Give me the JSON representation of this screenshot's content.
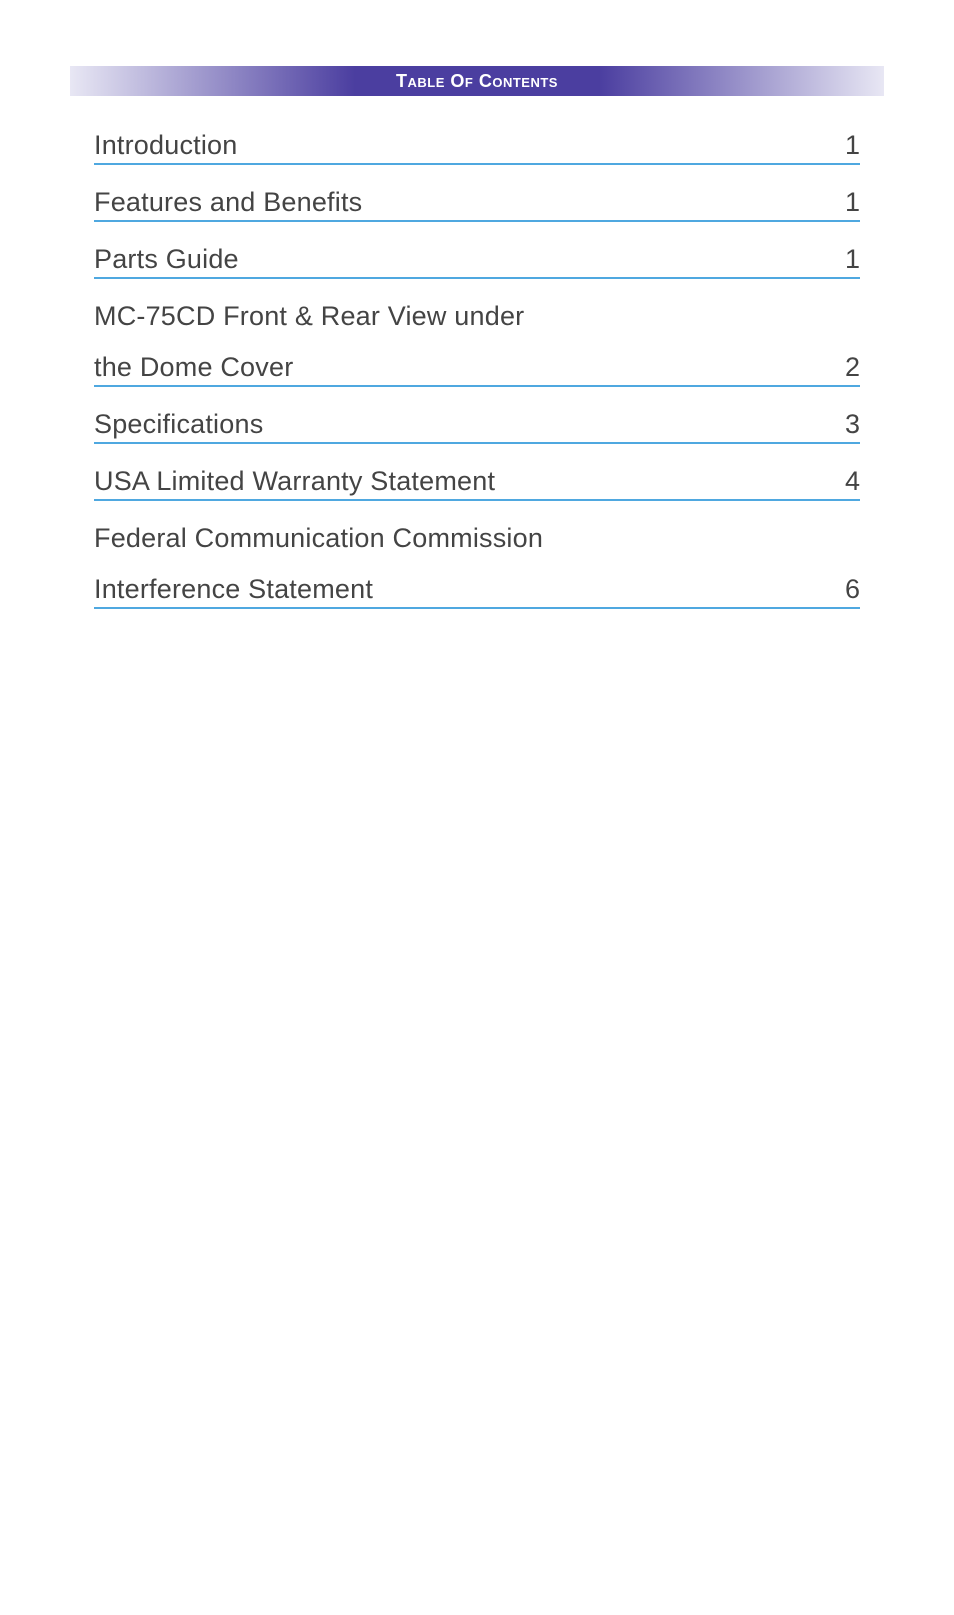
{
  "header": {
    "title": "Table Of Contents"
  },
  "toc": [
    {
      "title": "Introduction",
      "page": "1",
      "multiline": false
    },
    {
      "title": "Features and Benefits",
      "page": "1",
      "multiline": false
    },
    {
      "title": "Parts Guide",
      "page": "1",
      "multiline": false
    },
    {
      "title": "MC-75CD Front & Rear View under",
      "title2": "the Dome Cover",
      "page": "2",
      "multiline": true
    },
    {
      "title": "Specifications",
      "page": "3",
      "multiline": false
    },
    {
      "title": "USA Limited Warranty Statement",
      "page": "4",
      "multiline": false
    },
    {
      "title": "Federal Communication Commission",
      "title2": "Interference Statement",
      "page": "6",
      "multiline": true
    }
  ]
}
